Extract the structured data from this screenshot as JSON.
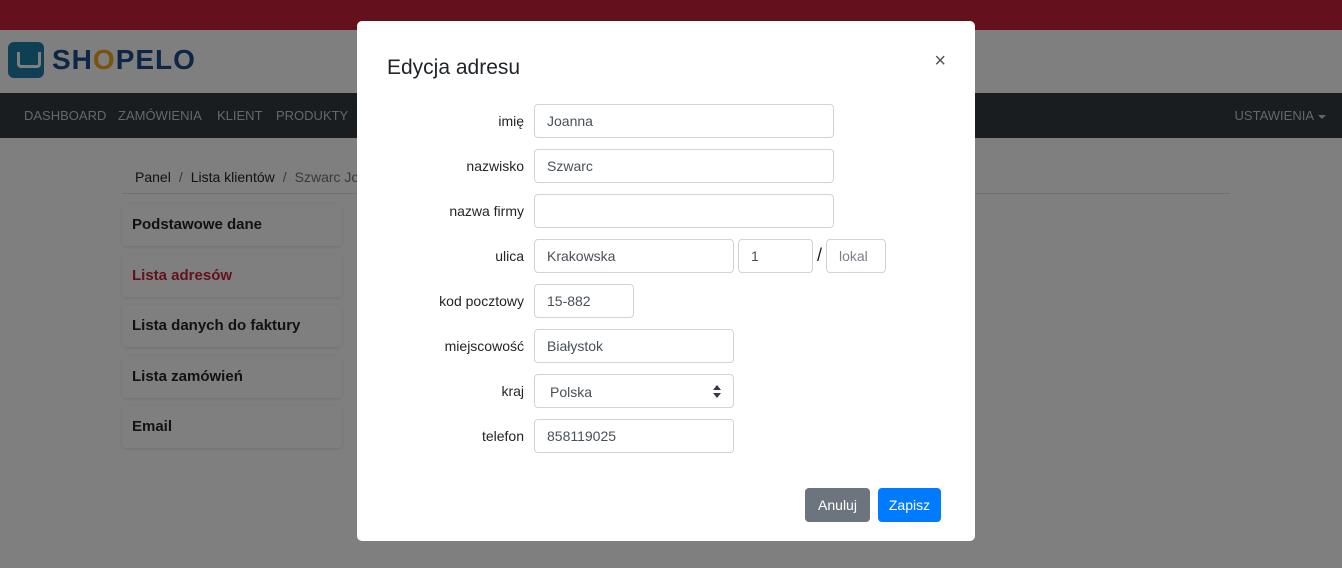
{
  "brand": {
    "logo_prefix": "SH",
    "logo_o": "O",
    "logo_suffix": "PELO",
    "accent_color": "#c8233a"
  },
  "nav": {
    "items": [
      "DASHBOARD",
      "ZAMÓWIENIA",
      "KLIENT",
      "PRODUKTY"
    ],
    "right_label": "USTAWIENIA"
  },
  "breadcrumb": {
    "items": [
      "Panel",
      "Lista klientów",
      "Szwarc Jo"
    ]
  },
  "sidebar": {
    "items": [
      "Podstawowe dane",
      "Lista adresów",
      "Lista danych do faktury",
      "Lista zamówień",
      "Email"
    ],
    "active": "Lista adresów"
  },
  "modal": {
    "title": "Edycja adresu",
    "close": "×",
    "fields": {
      "first_name": {
        "label": "imię",
        "value": "Joanna"
      },
      "last_name": {
        "label": "nazwisko",
        "value": "Szwarc"
      },
      "company": {
        "label": "nazwa firmy",
        "value": ""
      },
      "street": {
        "label": "ulica",
        "value": "Krakowska",
        "number": "1",
        "separator": "/",
        "apartment_placeholder": "lokal"
      },
      "postal_code": {
        "label": "kod pocztowy",
        "value": "15-882"
      },
      "city": {
        "label": "miejscowość",
        "value": "Białystok"
      },
      "country": {
        "label": "kraj",
        "value": "Polska"
      },
      "phone": {
        "label": "telefon",
        "value": "858119025"
      }
    },
    "cancel_label": "Anuluj",
    "save_label": "Zapisz"
  }
}
